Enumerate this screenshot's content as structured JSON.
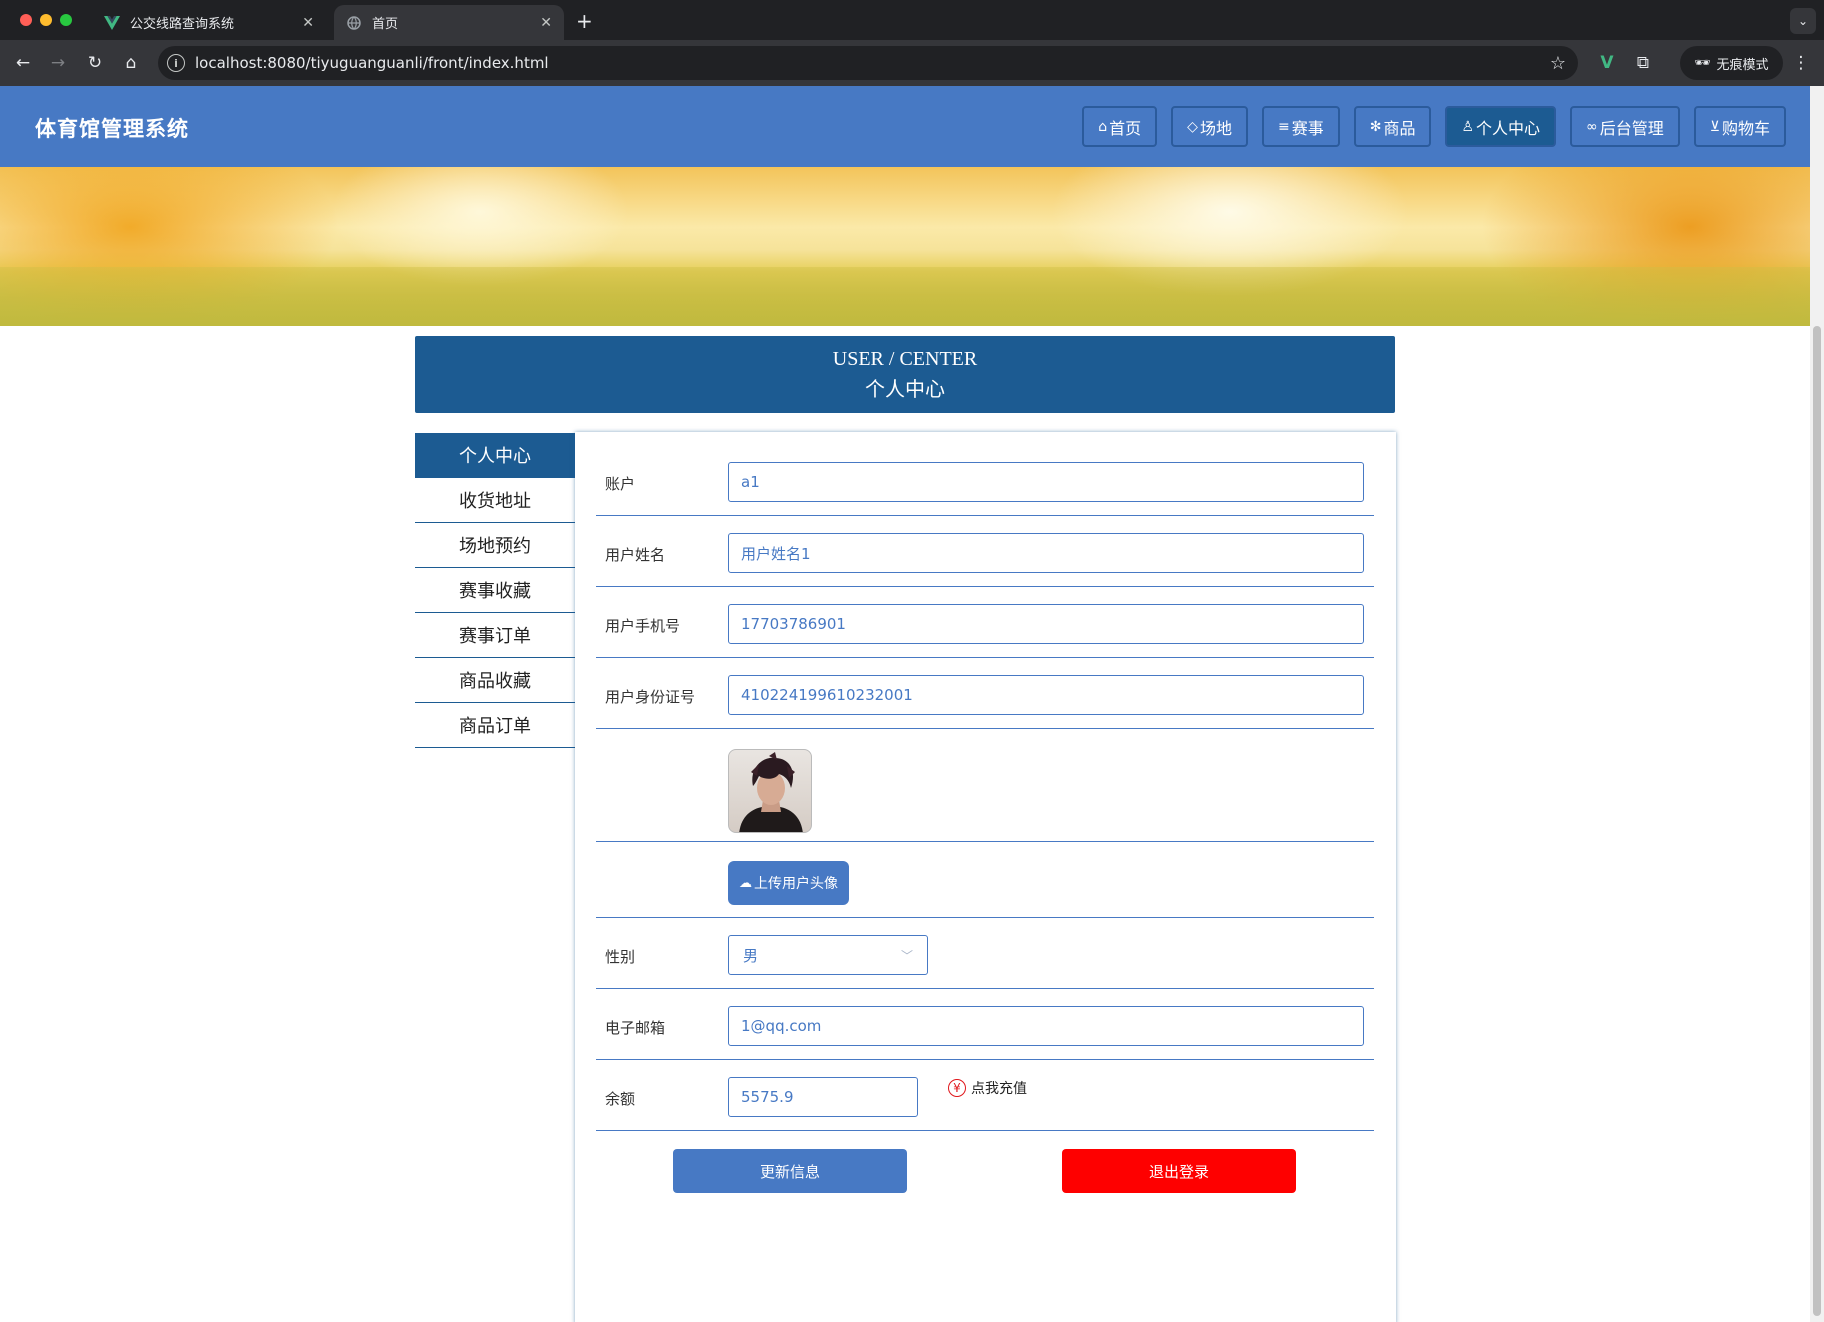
{
  "browser": {
    "tabs": [
      {
        "title": "公交线路查询系统",
        "active": false
      },
      {
        "title": "首页",
        "active": true
      }
    ],
    "url": "localhost:8080/tiyuguanguanli/front/index.html",
    "incognito_label": "无痕模式"
  },
  "header": {
    "brand": "体育馆管理系统",
    "nav": [
      {
        "label": "首页",
        "icon": "home-icon"
      },
      {
        "label": "场地",
        "icon": "tag-icon"
      },
      {
        "label": "赛事",
        "icon": "sliders-icon"
      },
      {
        "label": "商品",
        "icon": "snowflake-icon"
      },
      {
        "label": "个人中心",
        "icon": "user-icon",
        "active": true
      },
      {
        "label": "后台管理",
        "icon": "link-icon"
      },
      {
        "label": "购物车",
        "icon": "cart-icon"
      }
    ]
  },
  "carousel": {
    "slides": 3,
    "active_index": 0
  },
  "section": {
    "title_en": "USER / CENTER",
    "title_cn": "个人中心"
  },
  "sidebar": {
    "items": [
      {
        "label": "个人中心",
        "active": true
      },
      {
        "label": "收货地址"
      },
      {
        "label": "场地预约"
      },
      {
        "label": "赛事收藏"
      },
      {
        "label": "赛事订单"
      },
      {
        "label": "商品收藏"
      },
      {
        "label": "商品订单"
      }
    ]
  },
  "form": {
    "account": {
      "label": "账户",
      "value": "a1"
    },
    "name": {
      "label": "用户姓名",
      "value": "用户姓名1"
    },
    "phone": {
      "label": "用户手机号",
      "value": "17703786901"
    },
    "idcard": {
      "label": "用户身份证号",
      "value": "410224199610232001"
    },
    "upload_label": "上传用户头像",
    "gender": {
      "label": "性别",
      "value": "男"
    },
    "email": {
      "label": "电子邮箱",
      "value": "1@qq.com"
    },
    "balance": {
      "label": "余额",
      "value": "5575.9",
      "recharge_label": "点我充值"
    },
    "update_label": "更新信息",
    "logout_label": "退出登录"
  },
  "colors": {
    "primary": "#4779c4",
    "dark": "#1c5b92",
    "danger": "#fe0000"
  }
}
